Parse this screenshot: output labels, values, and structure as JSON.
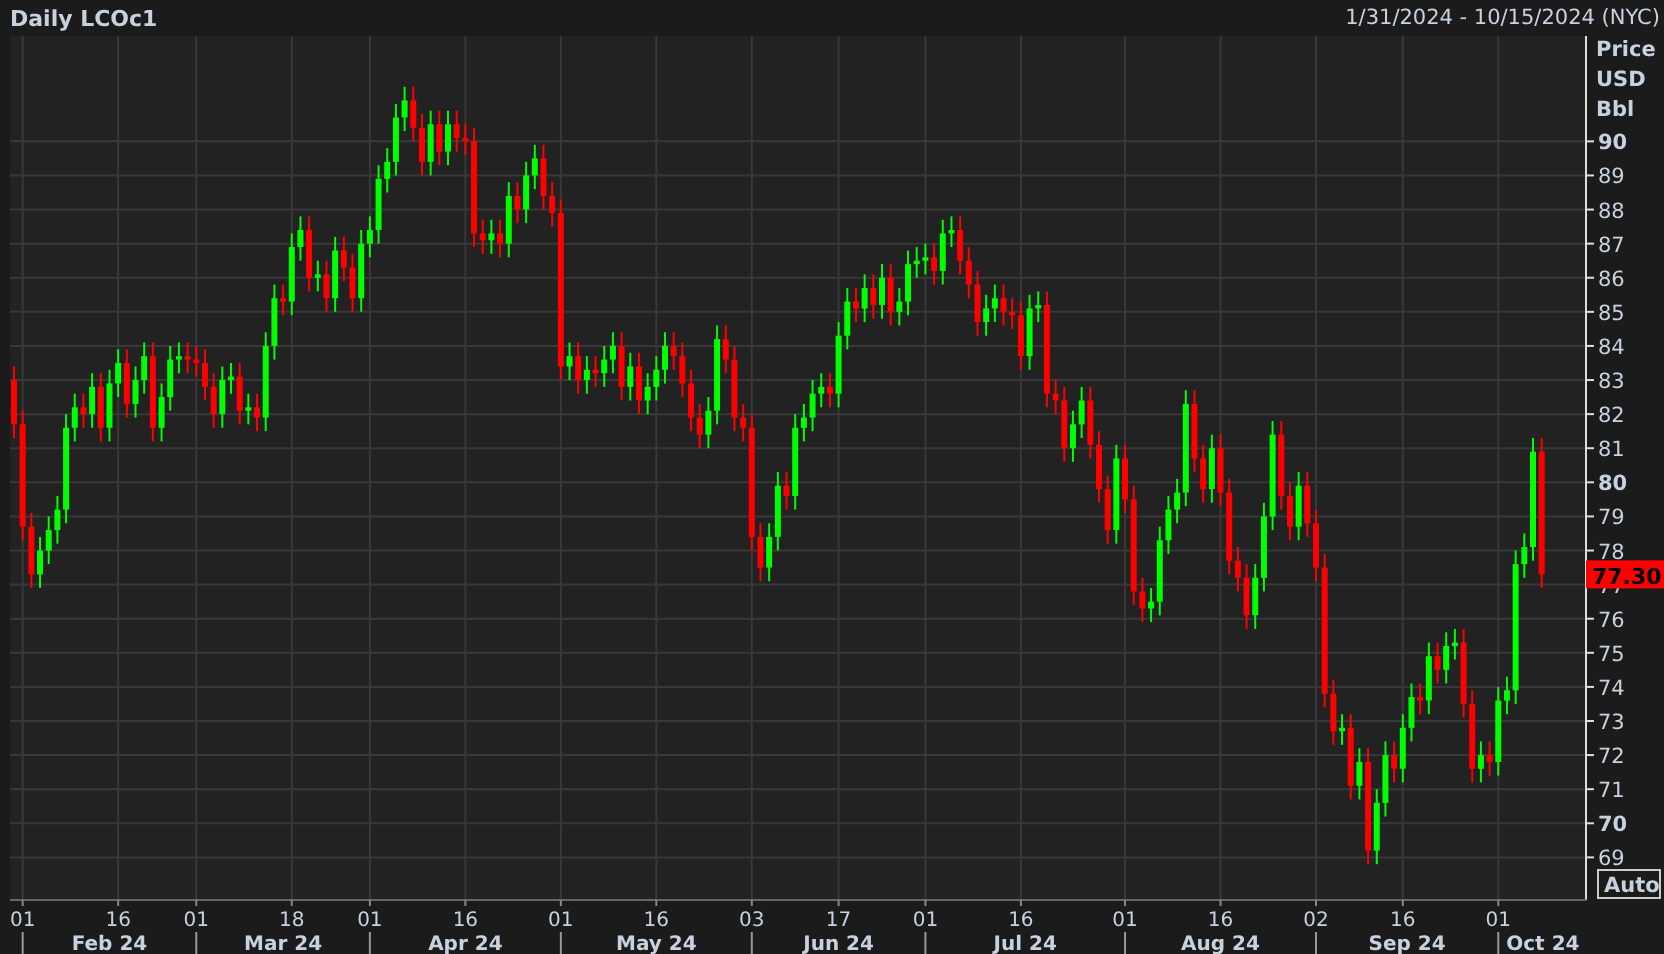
{
  "header": {
    "range": "1/31/2024 - 10/15/2024 (NYC)"
  },
  "chart": {
    "chart_data": {
      "type": "candlestick",
      "title": "Daily LCOc1",
      "ylabel": "Price USD Bbl",
      "ylim": [
        67.75,
        93.09
      ],
      "grid": true,
      "yticks": [
        69,
        70,
        71,
        72,
        73,
        74,
        75,
        76,
        77,
        78,
        79,
        80,
        81,
        82,
        83,
        84,
        85,
        86,
        87,
        88,
        89,
        90
      ],
      "categories": [
        null,
        "01",
        null,
        null,
        null,
        null,
        null,
        null,
        null,
        null,
        null,
        null,
        "16",
        null,
        null,
        null,
        null,
        null,
        null,
        null,
        null,
        "01",
        null,
        null,
        null,
        null,
        null,
        null,
        null,
        null,
        null,
        null,
        "18",
        null,
        null,
        null,
        null,
        null,
        null,
        null,
        null,
        "01",
        null,
        null,
        null,
        null,
        null,
        null,
        null,
        null,
        null,
        null,
        "16",
        null,
        null,
        null,
        null,
        null,
        null,
        null,
        null,
        null,
        null,
        "01",
        null,
        null,
        null,
        null,
        null,
        null,
        null,
        null,
        null,
        null,
        "16",
        null,
        null,
        null,
        null,
        null,
        null,
        null,
        null,
        null,
        null,
        "03",
        null,
        null,
        null,
        null,
        null,
        null,
        null,
        null,
        null,
        "17",
        null,
        null,
        null,
        null,
        null,
        null,
        null,
        null,
        null,
        "01",
        null,
        null,
        null,
        null,
        null,
        null,
        null,
        null,
        null,
        null,
        "16",
        null,
        null,
        null,
        null,
        null,
        null,
        null,
        null,
        null,
        null,
        null,
        "01",
        null,
        null,
        null,
        null,
        null,
        null,
        null,
        null,
        null,
        null,
        "16",
        null,
        null,
        null,
        null,
        null,
        null,
        null,
        null,
        null,
        null,
        "02",
        null,
        null,
        null,
        null,
        null,
        null,
        null,
        null,
        null,
        "16",
        null,
        null,
        null,
        null,
        null,
        null,
        null,
        null,
        null,
        null,
        "01",
        null,
        null,
        null,
        null,
        null
      ],
      "ohlc": [
        [
          83.0,
          83.4,
          81.3,
          81.7
        ],
        [
          81.7,
          82.1,
          78.3,
          78.7
        ],
        [
          78.7,
          79.1,
          76.9,
          77.3
        ],
        [
          77.3,
          78.4,
          76.9,
          78.0
        ],
        [
          78.0,
          79.0,
          77.6,
          78.6
        ],
        [
          78.6,
          79.6,
          78.2,
          79.2
        ],
        [
          79.2,
          82.0,
          78.8,
          81.6
        ],
        [
          81.6,
          82.6,
          81.2,
          82.2
        ],
        [
          82.2,
          82.6,
          81.6,
          82.0
        ],
        [
          82.0,
          83.2,
          81.6,
          82.8
        ],
        [
          82.8,
          83.2,
          81.2,
          81.6
        ],
        [
          81.6,
          83.3,
          81.2,
          82.9
        ],
        [
          82.9,
          83.9,
          82.5,
          83.5
        ],
        [
          83.5,
          83.9,
          81.9,
          82.3
        ],
        [
          82.3,
          83.4,
          81.9,
          83.0
        ],
        [
          83.0,
          84.1,
          82.6,
          83.7
        ],
        [
          83.7,
          84.1,
          81.2,
          81.6
        ],
        [
          81.6,
          82.9,
          81.2,
          82.5
        ],
        [
          82.5,
          84.0,
          82.1,
          83.6
        ],
        [
          83.6,
          84.1,
          83.2,
          83.7
        ],
        [
          83.7,
          84.1,
          83.2,
          83.6
        ],
        [
          83.6,
          84.0,
          83.1,
          83.5
        ],
        [
          83.5,
          83.9,
          82.4,
          82.8
        ],
        [
          82.8,
          83.2,
          81.6,
          82.0
        ],
        [
          82.0,
          83.4,
          81.6,
          83.0
        ],
        [
          83.0,
          83.5,
          82.6,
          83.1
        ],
        [
          83.1,
          83.5,
          81.7,
          82.1
        ],
        [
          82.1,
          82.6,
          81.7,
          82.2
        ],
        [
          82.2,
          82.6,
          81.5,
          81.9
        ],
        [
          81.9,
          84.4,
          81.5,
          84.0
        ],
        [
          84.0,
          85.8,
          83.6,
          85.4
        ],
        [
          85.4,
          85.8,
          84.9,
          85.3
        ],
        [
          85.3,
          87.3,
          84.9,
          86.9
        ],
        [
          86.9,
          87.8,
          86.5,
          87.4
        ],
        [
          87.4,
          87.8,
          85.6,
          86.0
        ],
        [
          86.0,
          86.5,
          85.6,
          86.1
        ],
        [
          86.1,
          86.5,
          85.0,
          85.4
        ],
        [
          85.4,
          87.2,
          85.0,
          86.8
        ],
        [
          86.8,
          87.2,
          85.9,
          86.3
        ],
        [
          86.3,
          86.7,
          85.0,
          85.4
        ],
        [
          85.4,
          87.4,
          85.0,
          87.0
        ],
        [
          87.0,
          87.8,
          86.6,
          87.4
        ],
        [
          87.4,
          89.3,
          87.0,
          88.9
        ],
        [
          88.9,
          89.8,
          88.5,
          89.4
        ],
        [
          89.4,
          91.1,
          89.0,
          90.7
        ],
        [
          90.7,
          91.6,
          90.3,
          91.2
        ],
        [
          91.2,
          91.6,
          90.0,
          90.4
        ],
        [
          90.4,
          90.8,
          89.0,
          89.4
        ],
        [
          89.4,
          90.9,
          89.0,
          90.5
        ],
        [
          90.5,
          90.9,
          89.3,
          89.7
        ],
        [
          89.7,
          90.9,
          89.3,
          90.5
        ],
        [
          90.5,
          90.9,
          89.7,
          90.1
        ],
        [
          90.1,
          90.5,
          89.6,
          90.0
        ],
        [
          90.0,
          90.4,
          86.9,
          87.3
        ],
        [
          87.3,
          87.7,
          86.7,
          87.1
        ],
        [
          87.1,
          87.7,
          86.7,
          87.3
        ],
        [
          87.3,
          87.7,
          86.6,
          87.0
        ],
        [
          87.0,
          88.8,
          86.6,
          88.4
        ],
        [
          88.4,
          88.8,
          87.6,
          88.0
        ],
        [
          88.0,
          89.4,
          87.6,
          89.0
        ],
        [
          89.0,
          89.9,
          88.6,
          89.5
        ],
        [
          89.5,
          89.9,
          88.0,
          88.4
        ],
        [
          88.4,
          88.8,
          87.5,
          87.9
        ],
        [
          87.9,
          88.3,
          83.0,
          83.4
        ],
        [
          83.4,
          84.1,
          83.0,
          83.7
        ],
        [
          83.7,
          84.1,
          82.6,
          83.0
        ],
        [
          83.0,
          83.7,
          82.6,
          83.3
        ],
        [
          83.3,
          83.7,
          82.8,
          83.2
        ],
        [
          83.2,
          84.0,
          82.8,
          83.6
        ],
        [
          83.6,
          84.4,
          83.2,
          84.0
        ],
        [
          84.0,
          84.4,
          82.4,
          82.8
        ],
        [
          82.8,
          83.8,
          82.4,
          83.4
        ],
        [
          83.4,
          83.8,
          82.0,
          82.4
        ],
        [
          82.4,
          83.2,
          82.0,
          82.8
        ],
        [
          82.8,
          83.7,
          82.4,
          83.3
        ],
        [
          83.3,
          84.4,
          82.9,
          84.0
        ],
        [
          84.0,
          84.4,
          83.3,
          83.7
        ],
        [
          83.7,
          84.1,
          82.5,
          82.9
        ],
        [
          82.9,
          83.3,
          81.5,
          81.9
        ],
        [
          81.9,
          82.3,
          81.0,
          81.4
        ],
        [
          81.4,
          82.5,
          81.0,
          82.1
        ],
        [
          82.1,
          84.6,
          81.7,
          84.2
        ],
        [
          84.2,
          84.6,
          83.2,
          83.6
        ],
        [
          83.6,
          84.0,
          81.5,
          81.9
        ],
        [
          81.9,
          82.3,
          81.2,
          81.6
        ],
        [
          81.6,
          82.0,
          78.0,
          78.4
        ],
        [
          78.4,
          78.8,
          77.1,
          77.5
        ],
        [
          77.5,
          78.8,
          77.1,
          78.4
        ],
        [
          78.4,
          80.3,
          78.0,
          79.9
        ],
        [
          79.9,
          80.3,
          79.2,
          79.6
        ],
        [
          79.6,
          82.0,
          79.2,
          81.6
        ],
        [
          81.6,
          82.3,
          81.2,
          81.9
        ],
        [
          81.9,
          83.0,
          81.5,
          82.6
        ],
        [
          82.6,
          83.2,
          82.2,
          82.8
        ],
        [
          82.8,
          83.2,
          82.2,
          82.6
        ],
        [
          82.6,
          84.7,
          82.2,
          84.3
        ],
        [
          84.3,
          85.7,
          83.9,
          85.3
        ],
        [
          85.3,
          85.7,
          84.7,
          85.1
        ],
        [
          85.1,
          86.1,
          84.7,
          85.7
        ],
        [
          85.7,
          86.1,
          84.8,
          85.2
        ],
        [
          85.2,
          86.4,
          84.8,
          86.0
        ],
        [
          86.0,
          86.4,
          84.6,
          85.0
        ],
        [
          85.0,
          85.7,
          84.6,
          85.3
        ],
        [
          85.3,
          86.8,
          84.9,
          86.4
        ],
        [
          86.4,
          86.9,
          86.0,
          86.5
        ],
        [
          86.5,
          87.0,
          86.1,
          86.6
        ],
        [
          86.6,
          87.0,
          85.8,
          86.2
        ],
        [
          86.2,
          87.7,
          85.8,
          87.3
        ],
        [
          87.3,
          87.8,
          86.9,
          87.4
        ],
        [
          87.4,
          87.8,
          86.1,
          86.5
        ],
        [
          86.5,
          86.9,
          85.4,
          85.8
        ],
        [
          85.8,
          86.2,
          84.3,
          84.7
        ],
        [
          84.7,
          85.5,
          84.3,
          85.1
        ],
        [
          85.1,
          85.8,
          84.7,
          85.4
        ],
        [
          85.4,
          85.8,
          84.6,
          85.0
        ],
        [
          85.0,
          85.4,
          84.5,
          84.9
        ],
        [
          84.9,
          85.3,
          83.3,
          83.7
        ],
        [
          83.7,
          85.5,
          83.3,
          85.1
        ],
        [
          85.1,
          85.6,
          84.7,
          85.2
        ],
        [
          85.2,
          85.6,
          82.2,
          82.6
        ],
        [
          82.6,
          83.0,
          82.0,
          82.4
        ],
        [
          82.4,
          82.8,
          80.6,
          81.0
        ],
        [
          81.0,
          82.1,
          80.6,
          81.7
        ],
        [
          81.7,
          82.8,
          81.3,
          82.4
        ],
        [
          82.4,
          82.8,
          80.7,
          81.1
        ],
        [
          81.1,
          81.5,
          79.4,
          79.8
        ],
        [
          79.8,
          80.2,
          78.2,
          78.6
        ],
        [
          78.6,
          81.1,
          78.2,
          80.7
        ],
        [
          80.7,
          81.1,
          79.1,
          79.5
        ],
        [
          79.5,
          79.9,
          76.4,
          76.8
        ],
        [
          76.8,
          77.2,
          75.9,
          76.3
        ],
        [
          76.3,
          76.9,
          75.9,
          76.5
        ],
        [
          76.5,
          78.7,
          76.1,
          78.3
        ],
        [
          78.3,
          79.6,
          77.9,
          79.2
        ],
        [
          79.2,
          80.1,
          78.8,
          79.7
        ],
        [
          79.7,
          82.7,
          79.3,
          82.3
        ],
        [
          82.3,
          82.7,
          80.3,
          80.7
        ],
        [
          80.7,
          81.1,
          79.4,
          79.8
        ],
        [
          79.8,
          81.4,
          79.4,
          81.0
        ],
        [
          81.0,
          81.4,
          79.3,
          79.7
        ],
        [
          79.7,
          80.1,
          77.3,
          77.7
        ],
        [
          77.7,
          78.1,
          76.8,
          77.2
        ],
        [
          77.2,
          77.6,
          75.7,
          76.1
        ],
        [
          76.1,
          77.6,
          75.7,
          77.2
        ],
        [
          77.2,
          79.4,
          76.8,
          79.0
        ],
        [
          79.0,
          81.8,
          78.6,
          81.4
        ],
        [
          81.4,
          81.8,
          79.2,
          79.6
        ],
        [
          79.6,
          80.0,
          78.3,
          78.7
        ],
        [
          78.7,
          80.3,
          78.3,
          79.9
        ],
        [
          79.9,
          80.3,
          78.4,
          78.8
        ],
        [
          78.8,
          79.2,
          77.1,
          77.5
        ],
        [
          77.5,
          77.9,
          73.4,
          73.8
        ],
        [
          73.8,
          74.2,
          72.3,
          72.7
        ],
        [
          72.7,
          73.2,
          72.3,
          72.8
        ],
        [
          72.8,
          73.2,
          70.7,
          71.1
        ],
        [
          71.1,
          72.2,
          70.7,
          71.8
        ],
        [
          71.8,
          72.2,
          68.8,
          69.2
        ],
        [
          69.2,
          71.0,
          68.8,
          70.6
        ],
        [
          70.6,
          72.4,
          70.2,
          72.0
        ],
        [
          72.0,
          72.4,
          71.2,
          71.6
        ],
        [
          71.6,
          73.2,
          71.2,
          72.8
        ],
        [
          72.8,
          74.1,
          72.4,
          73.7
        ],
        [
          73.7,
          74.1,
          73.2,
          73.6
        ],
        [
          73.6,
          75.3,
          73.2,
          74.9
        ],
        [
          74.9,
          75.3,
          74.1,
          74.5
        ],
        [
          74.5,
          75.6,
          74.1,
          75.2
        ],
        [
          75.2,
          75.7,
          74.8,
          75.3
        ],
        [
          75.3,
          75.7,
          73.1,
          73.5
        ],
        [
          73.5,
          73.9,
          71.2,
          71.6
        ],
        [
          71.6,
          72.4,
          71.2,
          72.0
        ],
        [
          72.0,
          72.4,
          71.4,
          71.8
        ],
        [
          71.8,
          74.0,
          71.4,
          73.6
        ],
        [
          73.6,
          74.3,
          73.2,
          73.9
        ],
        [
          73.9,
          78.0,
          73.5,
          77.6
        ],
        [
          77.6,
          78.5,
          77.2,
          78.1
        ],
        [
          78.1,
          81.3,
          77.7,
          80.9
        ],
        [
          80.9,
          81.3,
          76.9,
          77.3
        ]
      ],
      "annotations": [
        "77.30"
      ]
    },
    "month_labels": [
      "Feb 24",
      "Mar 24",
      "Apr 24",
      "May 24",
      "Jun 24",
      "Jul 24",
      "Aug 24",
      "Sep 24",
      "Oct 24"
    ],
    "scale_button": "Auto"
  }
}
